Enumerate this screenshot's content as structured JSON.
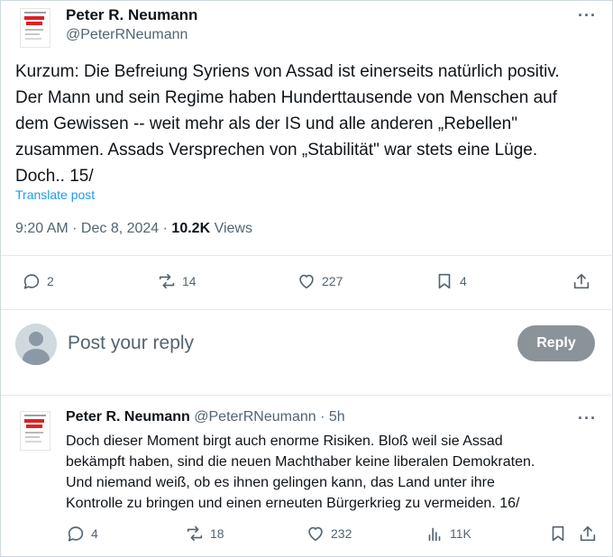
{
  "post": {
    "author_name": "Peter R. Neumann",
    "author_handle": "@PeterRNeumann",
    "more_label": "···",
    "text_lines": [
      "Kurzum: Die Befreiung Syriens von Assad ist einerseits natürlich positiv.",
      "Der Mann und sein Regime haben Hunderttausende von Menschen auf",
      "dem Gewissen -- weit mehr als der IS und alle anderen „Rebellen\"",
      "zusammen. Assads Versprechen von „Stabilität\" war stets eine Lüge.",
      "Doch.. 15/"
    ],
    "translate_label": "Translate post",
    "time": "9:20 AM",
    "sep1": " · ",
    "date": "Dec 8, 2024",
    "sep2": " · ",
    "views_count": "10.2K",
    "views_label": " Views",
    "actions": {
      "replies": "2",
      "reposts": "14",
      "likes": "227",
      "bookmarks": "4"
    }
  },
  "composer": {
    "placeholder": "Post your reply",
    "reply_button": "Reply"
  },
  "reply": {
    "author_name": "Peter R. Neumann",
    "author_handle": "@PeterRNeumann",
    "sep": " · ",
    "age": "5h",
    "more_label": "···",
    "text_lines": [
      "Doch dieser Moment birgt auch enorme Risiken. Bloß weil sie Assad",
      "bekämpft haben, sind die neuen Machthaber keine liberalen Demokraten.",
      "Und niemand weiß, ob es ihnen gelingen kann, das Land unter ihre",
      "Kontrolle zu bringen und einen erneuten Bürgerkrieg zu vermeiden. 16/"
    ],
    "actions": {
      "replies": "4",
      "reposts": "18",
      "likes": "232",
      "views": "11K"
    }
  }
}
